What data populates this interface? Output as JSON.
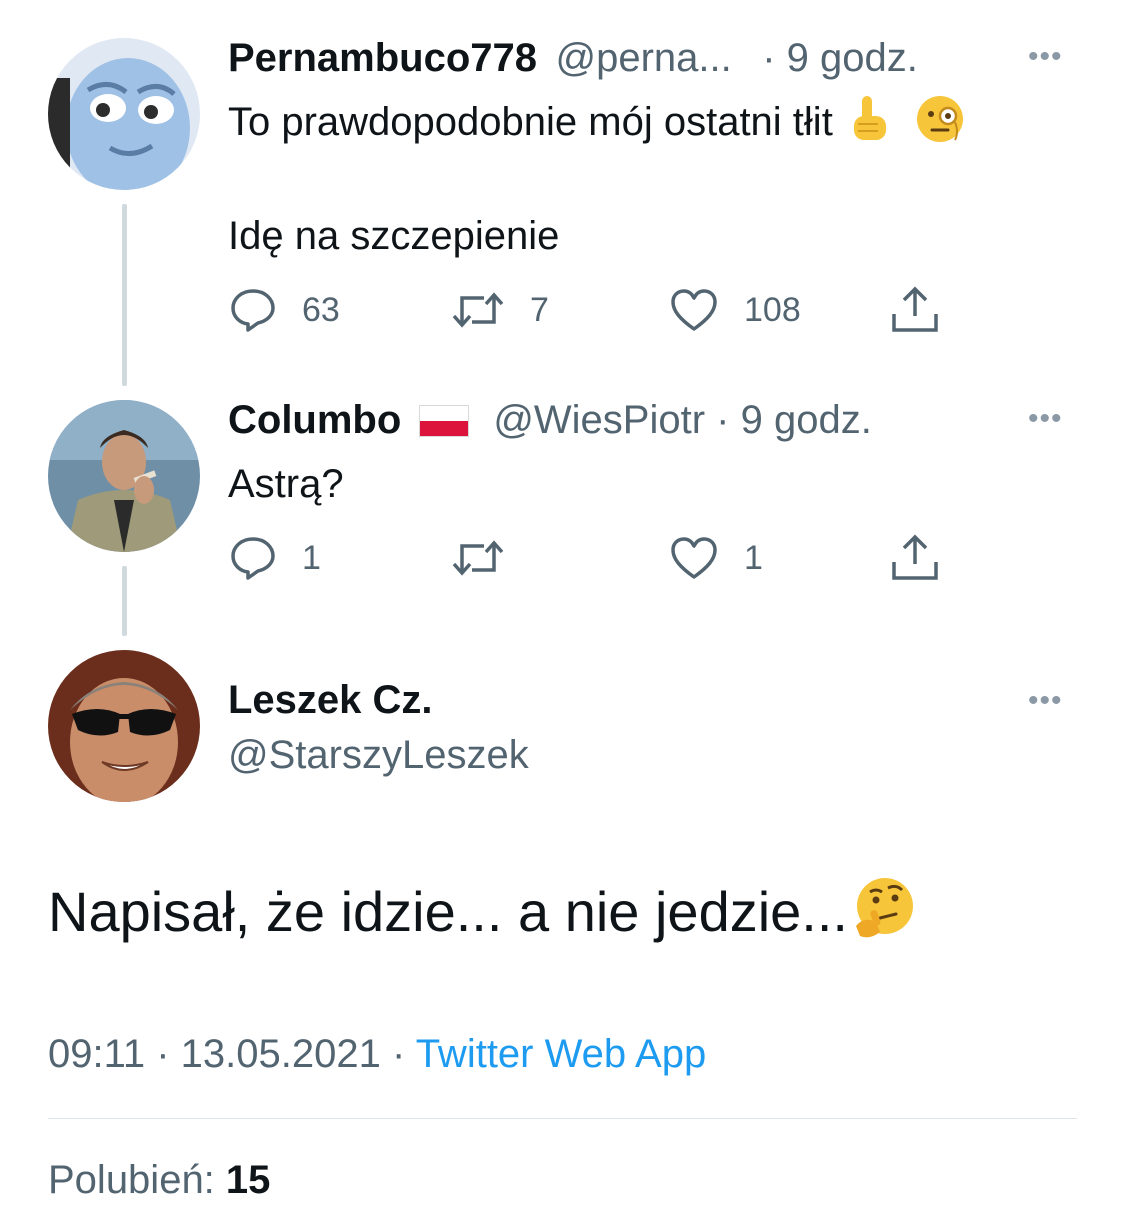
{
  "tweets": [
    {
      "name": "Pernambuco778",
      "handle": "@perna...",
      "time": "· 9 godz.",
      "text_line1": "To prawdopodobnie mój ostatni tłit",
      "text_line2": "Idę na szczepienie",
      "emojis": [
        "pointing-up-emoji",
        "face-with-monocle-emoji"
      ],
      "counts": {
        "replies": "63",
        "retweets": "7",
        "likes": "108"
      }
    },
    {
      "name": "Columbo",
      "flag": "poland-flag",
      "handle": "@WiesPiotr · 9 godz.",
      "text": "Astrą?",
      "counts": {
        "replies": "1",
        "retweets": "",
        "likes": "1"
      }
    }
  ],
  "main_tweet": {
    "name": "Leszek Cz.",
    "handle": "@StarszyLeszek",
    "text": "Napisał, że idzie... a nie jedzie...",
    "emoji": "thinking-face-emoji",
    "timestamp": "09:11 · 13.05.2021 · ",
    "source": "Twitter Web App",
    "likes_label": "Polubień: ",
    "likes_count": "15"
  },
  "colors": {
    "text": "#0f1419",
    "secondary": "#536471",
    "link": "#1d9bf0",
    "thread_line": "#cfd9de"
  },
  "more_icon": "more-dots-icon"
}
